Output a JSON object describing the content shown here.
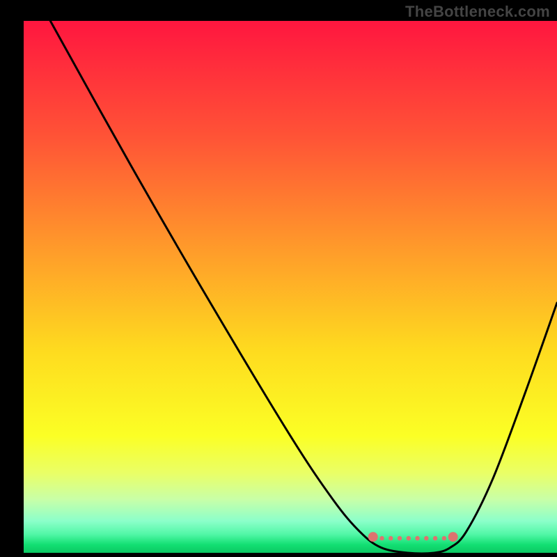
{
  "attribution": "TheBottleneck.com",
  "chart_data": {
    "type": "line",
    "title": "",
    "xlabel": "",
    "ylabel": "",
    "xlim": [
      0,
      100
    ],
    "ylim": [
      0,
      100
    ],
    "background": {
      "type": "vertical-gradient",
      "stops": [
        {
          "offset": 0.0,
          "color": "#ff163f"
        },
        {
          "offset": 0.22,
          "color": "#ff5436"
        },
        {
          "offset": 0.45,
          "color": "#ffa229"
        },
        {
          "offset": 0.62,
          "color": "#fedb1f"
        },
        {
          "offset": 0.78,
          "color": "#fbff25"
        },
        {
          "offset": 0.85,
          "color": "#eaff66"
        },
        {
          "offset": 0.9,
          "color": "#c8ffa8"
        },
        {
          "offset": 0.94,
          "color": "#8cffca"
        },
        {
          "offset": 0.965,
          "color": "#52f7a7"
        },
        {
          "offset": 0.985,
          "color": "#12df72"
        },
        {
          "offset": 1.0,
          "color": "#0cc863"
        }
      ]
    },
    "series": [
      {
        "name": "bottleneck-curve",
        "color": "#000000",
        "points": [
          {
            "x": 5,
            "y": 100
          },
          {
            "x": 20,
            "y": 73
          },
          {
            "x": 35,
            "y": 47
          },
          {
            "x": 50,
            "y": 22
          },
          {
            "x": 58,
            "y": 10
          },
          {
            "x": 63,
            "y": 4
          },
          {
            "x": 67,
            "y": 1
          },
          {
            "x": 72,
            "y": 0
          },
          {
            "x": 77,
            "y": 0
          },
          {
            "x": 80,
            "y": 1
          },
          {
            "x": 83,
            "y": 4
          },
          {
            "x": 88,
            "y": 14
          },
          {
            "x": 94,
            "y": 30
          },
          {
            "x": 100,
            "y": 47
          }
        ]
      }
    ],
    "optimal_band": {
      "color": "#dd736f",
      "x_start": 65.5,
      "x_end": 80.5,
      "y": 3
    }
  }
}
